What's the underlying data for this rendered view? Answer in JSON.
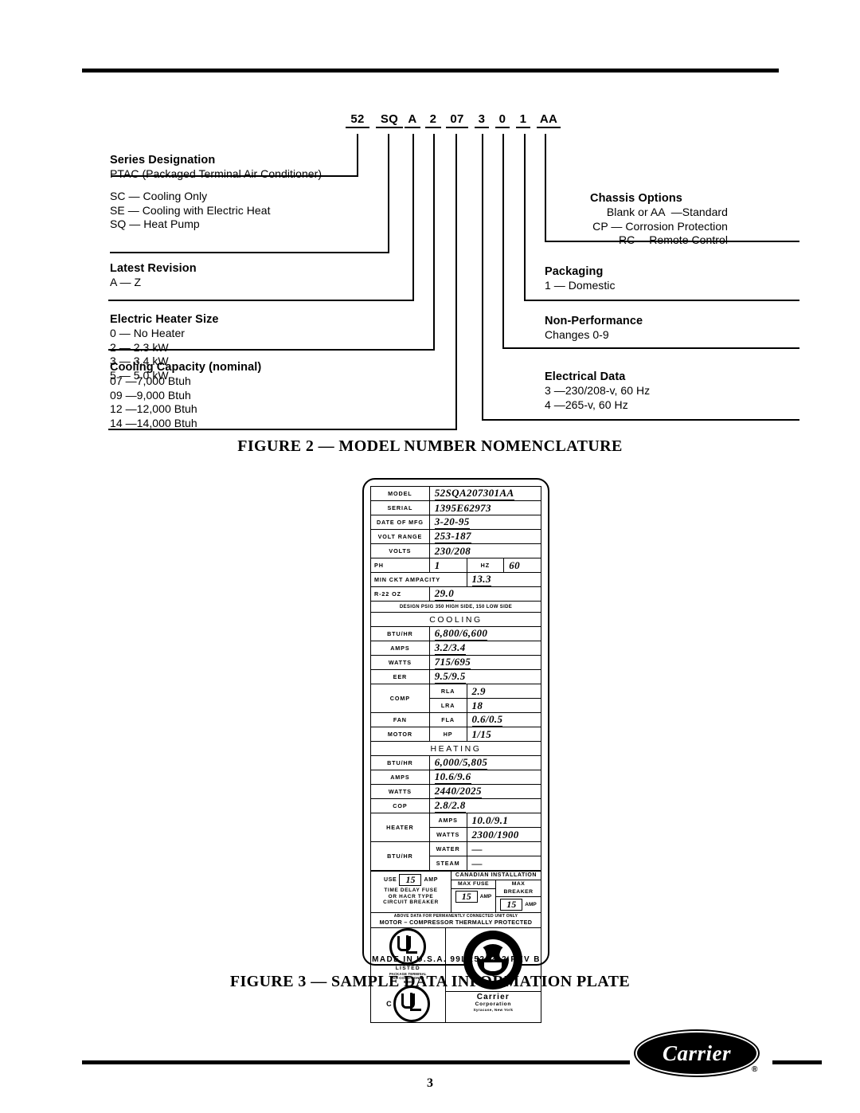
{
  "document": {
    "page_number": "3",
    "brand": "Carrier",
    "brand_reg": "®"
  },
  "figure2": {
    "caption": "FIGURE 2 — MODEL NUMBER NOMENCLATURE",
    "model_code": [
      "52",
      "SQ",
      "A",
      "2",
      "07",
      "3",
      "0",
      "1",
      "AA"
    ],
    "left_blocks": [
      {
        "heading": "Series Designation",
        "lines": [
          "PTAC (Packaged Terminal Air Conditioner)"
        ]
      },
      {
        "heading": "",
        "lines": [
          "SC — Cooling Only",
          "SE — Cooling with Electric Heat",
          "SQ — Heat Pump"
        ]
      },
      {
        "heading": "Latest Revision",
        "lines": [
          "A — Z"
        ]
      },
      {
        "heading": "Electric Heater Size",
        "lines": [
          "0 — No Heater",
          "2 — 2.3 kW",
          "3 — 3.4 kW",
          "5 — 5.0 kW"
        ]
      },
      {
        "heading": "Cooling Capacity (nominal)",
        "lines": [
          "07 —7,000 Btuh",
          "09 —9,000 Btuh",
          "12 —12,000 Btuh",
          "14 —14,000 Btuh"
        ]
      }
    ],
    "right_blocks": [
      {
        "heading": "Chassis Options",
        "lines": [
          "Blank or AA  —Standard",
          "CP — Corrosion Protection",
          "RC —Remote Control"
        ]
      },
      {
        "heading": "Packaging",
        "lines": [
          "1 — Domestic"
        ]
      },
      {
        "heading": "Non-Performance",
        "lines": [
          "Changes 0-9"
        ]
      },
      {
        "heading": "Electrical Data",
        "lines": [
          "3 —230/208-v, 60 Hz",
          "4 —265-v, 60 Hz"
        ]
      }
    ]
  },
  "figure3": {
    "caption": "FIGURE 3 — SAMPLE DATA INFORMATION PLATE",
    "plate": {
      "rows": [
        {
          "label": "MODEL",
          "value": "52SQA207301AA"
        },
        {
          "label": "SERIAL",
          "value": "1395E62973"
        },
        {
          "label": "DATE OF MFG",
          "value": "3-20-95"
        },
        {
          "label": "VOLT RANGE",
          "value": "253-187"
        },
        {
          "label": "VOLTS",
          "value": "230/208"
        }
      ],
      "ph_label": "PH",
      "ph_value": "1",
      "hz_label": "HZ",
      "hz_value": "60",
      "ampacity_label": "MIN CKT AMPACITY",
      "ampacity_value": "13.3",
      "refrigerant_label": "R-22 OZ",
      "refrigerant_value": "29.0",
      "design_psig": "DESIGN PSIG 350 HIGH SIDE, 150 LOW SIDE",
      "cooling_title": "COOLING",
      "cooling_rows": [
        {
          "label": "BTU/HR",
          "value": "6,800/6,600"
        },
        {
          "label": "AMPS",
          "value": "3.2/3.4"
        },
        {
          "label": "WATTS",
          "value": "715/695"
        },
        {
          "label": "EER",
          "value": "9.5/9.5"
        }
      ],
      "comp_label": "COMP",
      "comp_rows": [
        {
          "label": "RLA",
          "value": "2.9"
        },
        {
          "label": "LRA",
          "value": "18"
        }
      ],
      "fan_label": "FAN",
      "motor_label": "MOTOR",
      "fan_rows": [
        {
          "label": "FLA",
          "value": "0.6/0.5"
        },
        {
          "label": "HP",
          "value": "1/15"
        }
      ],
      "heating_title": "HEATING",
      "heating_rows": [
        {
          "label": "BTU/HR",
          "value": "6,000/5,805"
        },
        {
          "label": "AMPS",
          "value": "10.6/9.6"
        },
        {
          "label": "WATTS",
          "value": "2440/2025"
        },
        {
          "label": "COP",
          "value": "2.8/2.8"
        }
      ],
      "heater_label": "HEATER",
      "heater_rows": [
        {
          "label": "AMPS",
          "value": "10.0/9.1"
        },
        {
          "label": "WATTS",
          "value": "2300/1900"
        }
      ],
      "btuhr_label": "BTU/HR",
      "btuhr_rows": [
        {
          "label": "WATER",
          "value": "—"
        },
        {
          "label": "STEAM",
          "value": "—"
        }
      ],
      "fuse": {
        "use_word": "USE",
        "use_value": "15",
        "amp_word": "AMP",
        "caption": "TIME DELAY FUSE\nOR HACR TYPE\nCIRCUIT BREAKER"
      },
      "canadian": {
        "title": "CANADIAN INSTALLATION",
        "max_fuse_label": "MAX FUSE",
        "max_fuse_value": "15",
        "max_fuse_unit": "AMP",
        "max_breaker_label": "MAX BREAKER",
        "max_breaker_value": "15",
        "max_breaker_unit": "AMP"
      },
      "note_line1": "ABOVE DATA FOR PERMANENTLY CONNECTED UNIT ONLY",
      "note_line2": "MOTOR – COMPRESSOR THERMALLY PROTECTED",
      "ul": {
        "listed_word": "LISTED",
        "listed_sub": "PACKAGE TERMINAL\nAIR CONDITIONER\n94H0",
        "c_prefix": "C"
      },
      "carrier_block": {
        "line1": "Carrier",
        "line2": "Corporation",
        "line3": "Syracuse, New York"
      },
      "made_in": "MADE IN U.S.A.  99LR520212 REV B"
    }
  }
}
